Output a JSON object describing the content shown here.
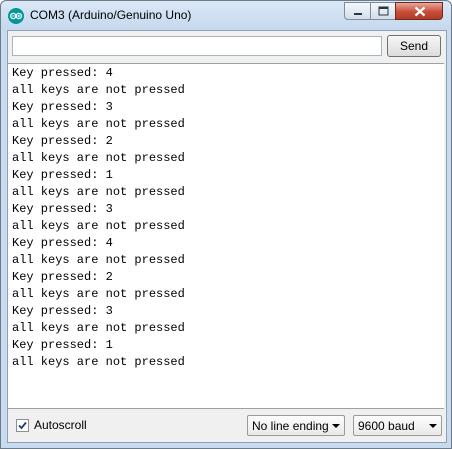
{
  "window": {
    "title": "COM3 (Arduino/Genuino Uno)"
  },
  "colors": {
    "arduino_teal": "#00979c",
    "close_red": "#c74d38"
  },
  "input": {
    "value": "",
    "placeholder": ""
  },
  "send_button": {
    "label": "Send"
  },
  "output_lines": [
    "Key pressed: 4",
    "all keys are not pressed",
    "Key pressed: 3",
    "all keys are not pressed",
    "Key pressed: 2",
    "all keys are not pressed",
    "Key pressed: 1",
    "all keys are not pressed",
    "Key pressed: 3",
    "all keys are not pressed",
    "Key pressed: 4",
    "all keys are not pressed",
    "Key pressed: 2",
    "all keys are not pressed",
    "Key pressed: 3",
    "all keys are not pressed",
    "Key pressed: 1",
    "all keys are not pressed"
  ],
  "autoscroll": {
    "label": "Autoscroll",
    "checked": true
  },
  "line_ending": {
    "selected": "No line ending"
  },
  "baud": {
    "selected": "9600 baud"
  }
}
